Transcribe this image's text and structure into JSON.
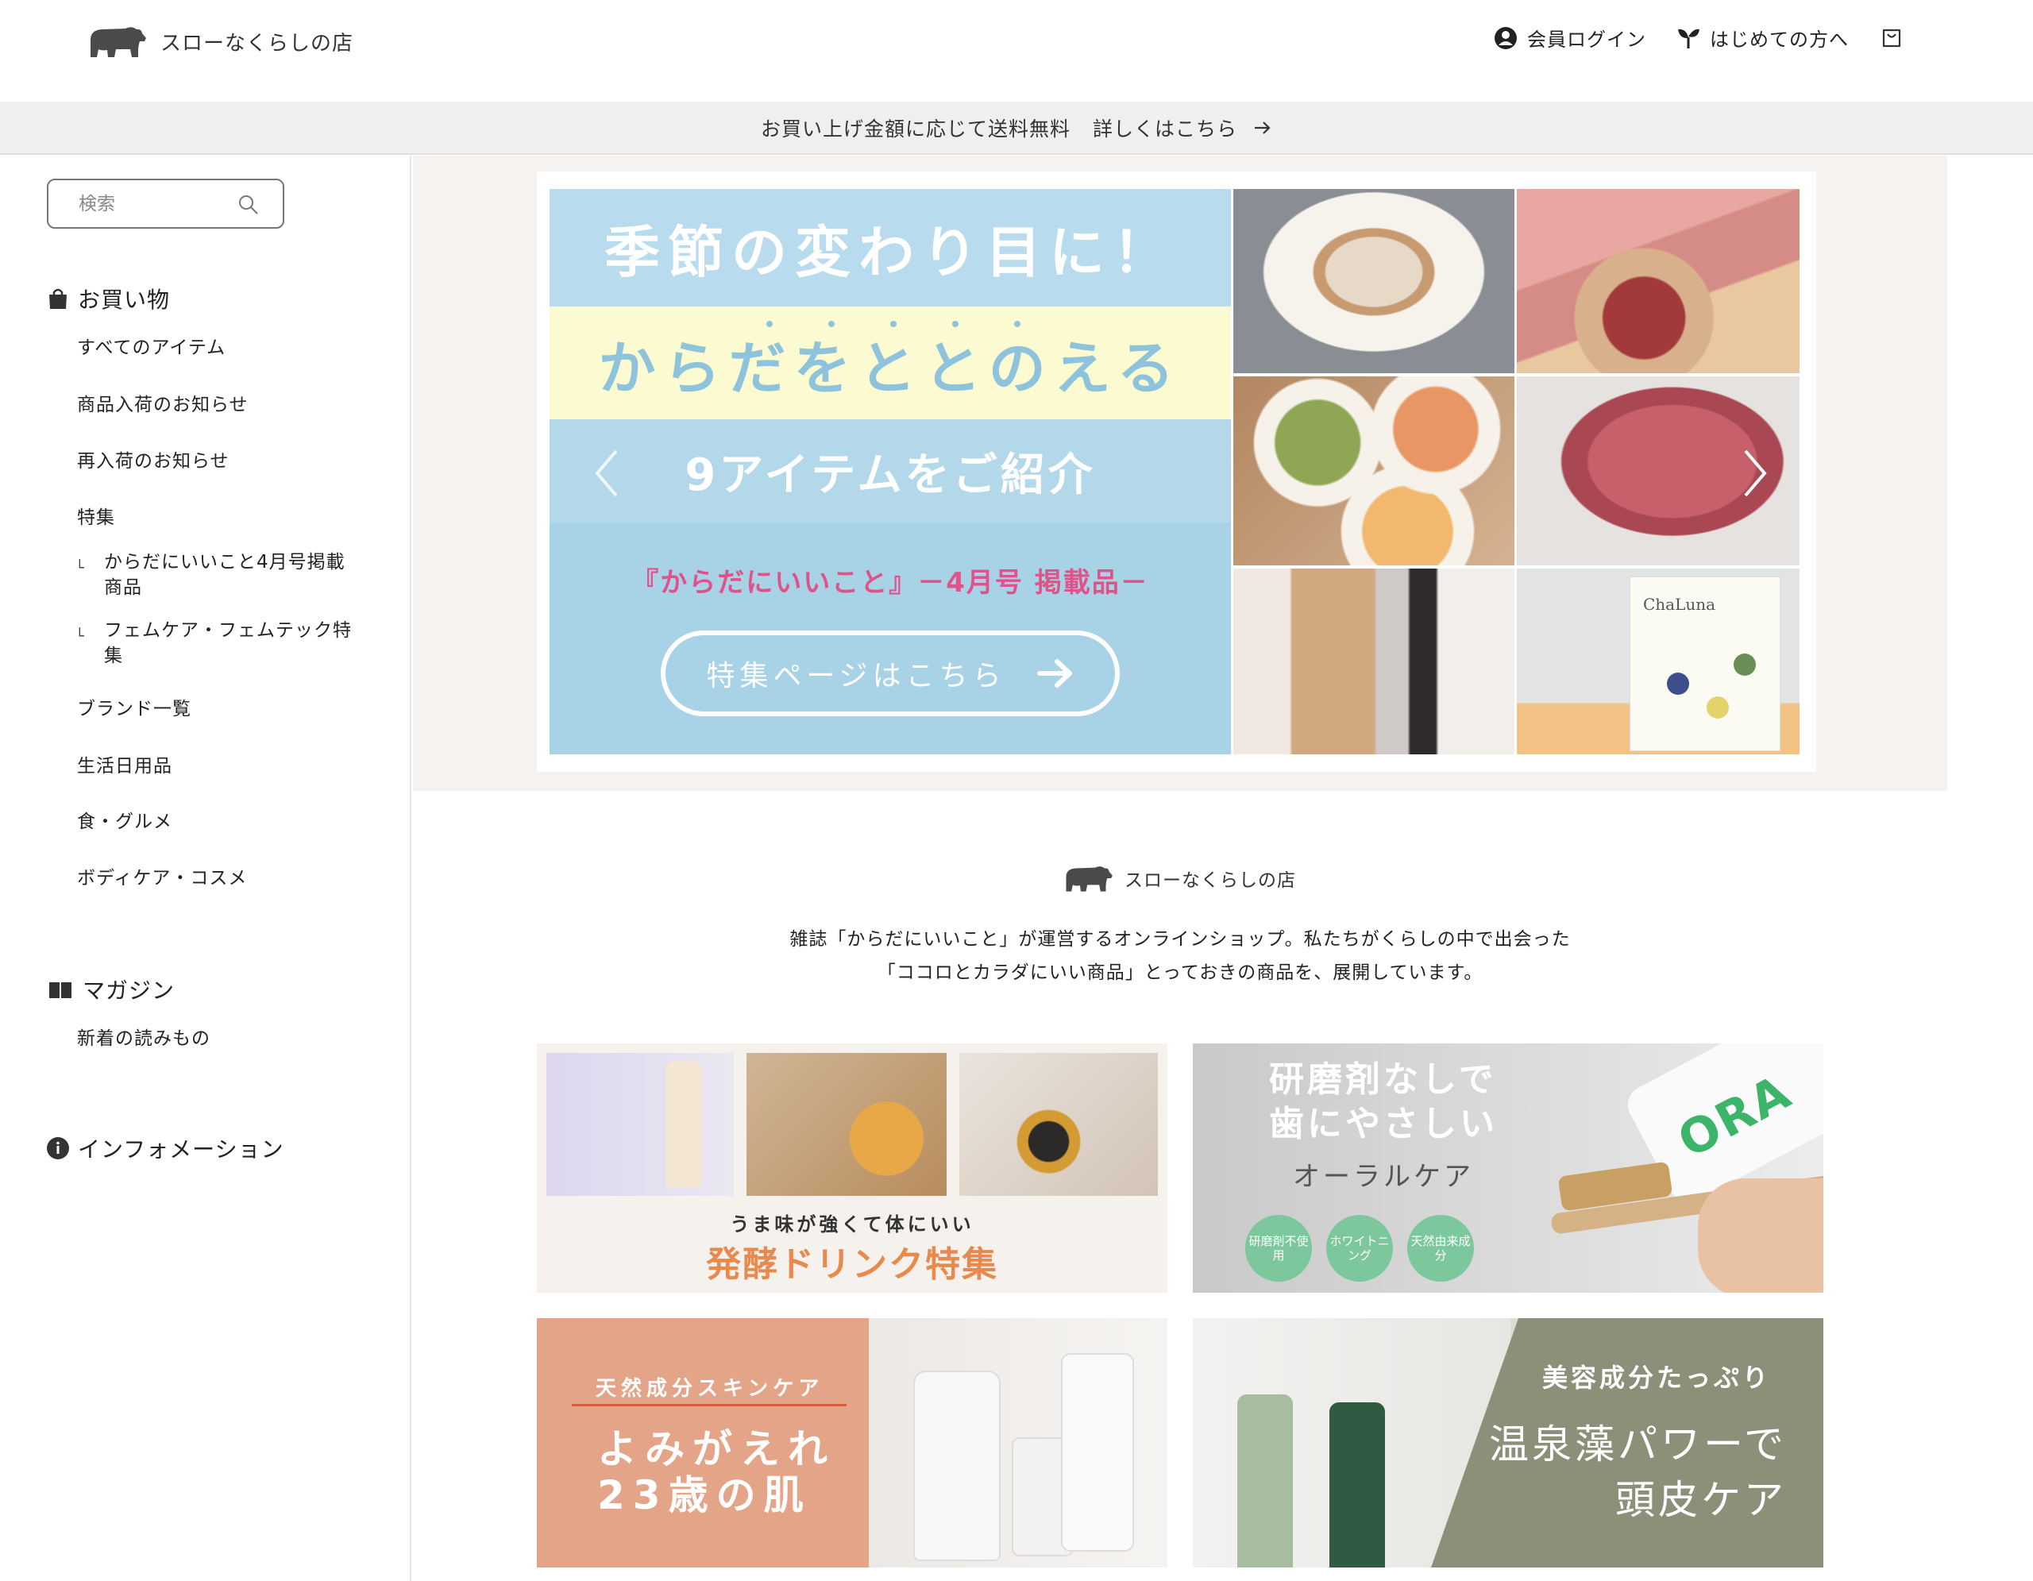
{
  "header": {
    "shop_name": "スローなくらしの店",
    "login_label": "会員ログイン",
    "beginner_label": "はじめての方へ"
  },
  "announcement": {
    "text": "お買い上げ金額に応じて送料無料",
    "link_label": "詳しくはこちら"
  },
  "search": {
    "placeholder": "検索"
  },
  "sidebar": {
    "shopping_title": "お買い物",
    "shopping_items": [
      "すべてのアイテム",
      "商品入荷のお知らせ",
      "再入荷のお知らせ",
      "特集"
    ],
    "sub_items": [
      "からだにいいこと4月号掲載商品",
      "フェムケア・フェムテック特集"
    ],
    "more_items": [
      "ブランド一覧",
      "生活日用品",
      "食・グルメ",
      "ボディケア・コスメ"
    ],
    "magazine_title": "マガジン",
    "magazine_items": [
      "新着の読みもの"
    ],
    "info_title": "インフォメーション"
  },
  "hero": {
    "line1": "季節の変わり目に！",
    "line2": "からだをととのえる",
    "line3": "9アイテムをご紹介",
    "magazine": "『からだにいいこと』－4月号 掲載品－",
    "button_label": "特集ページはこちら",
    "product_box_label": "ChaLuna"
  },
  "about": {
    "shop_name": "スローなくらしの店",
    "line1": "雑誌「からだにいいこと」が運営するオンラインショップ。私たちがくらしの中で出会った",
    "line2": "「ココロとカラダにいい商品」とっておきの商品を、展開しています。"
  },
  "banners": {
    "b1_sub": "うま味が強くて体にいい",
    "b1_title": "発酵ドリンク特集",
    "b2_title_l1": "研磨剤なしで",
    "b2_title_l2": "歯にやさしい",
    "b2_sub": "オーラルケア",
    "b2_badges": [
      "研磨剤不使用",
      "ホワイトニング",
      "天然由来成分"
    ],
    "b2_tube": "ORA",
    "b3_sub": "天然成分スキンケア",
    "b3_title_l1": "よみがえれ",
    "b3_title_l2": "23歳の肌",
    "b4_sub": "美容成分たっぷり",
    "b4_title_l1": "温泉藻パワーで",
    "b4_title_l2": "頭皮ケア"
  },
  "colors": {
    "hero_blue": "#a8d2e6",
    "hero_yellow": "#fbfad0",
    "magazine_pink": "#e0538a",
    "drink_orange": "#e88a4e",
    "oral_green": "#7cc79b",
    "skincare_peach": "#e3a487",
    "scalp_olive": "#8b9178"
  },
  "icons": [
    "bear-logo-icon",
    "user-circle-icon",
    "sprout-icon",
    "cart-icon",
    "search-icon",
    "shopping-bag-icon",
    "book-icon",
    "info-icon",
    "arrow-right-icon",
    "chevron-left-icon",
    "chevron-right-icon"
  ]
}
